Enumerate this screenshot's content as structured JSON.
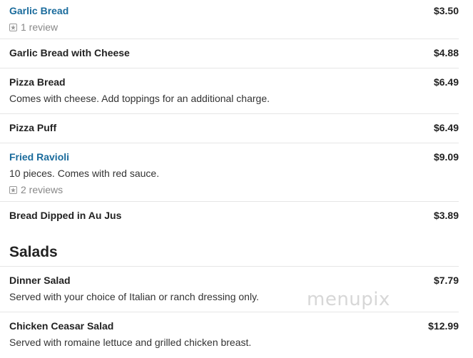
{
  "items": [
    {
      "name": "Garlic Bread",
      "price": "$3.50",
      "reviews": "1 review"
    },
    {
      "name": "Garlic Bread with Cheese",
      "price": "$4.88"
    },
    {
      "name": "Pizza Bread",
      "price": "$6.49",
      "description": "Comes with cheese. Add toppings for an additional charge."
    },
    {
      "name": "Pizza Puff",
      "price": "$6.49"
    },
    {
      "name": "Fried Ravioli",
      "price": "$9.09",
      "description": "10 pieces. Comes with red sauce.",
      "reviews": "2 reviews"
    },
    {
      "name": "Bread Dipped in Au Jus",
      "price": "$3.89"
    }
  ],
  "salads_section": {
    "title": "Salads",
    "items": [
      {
        "name": "Dinner Salad",
        "price": "$7.79",
        "description": "Served with your choice of Italian or ranch dressing only."
      },
      {
        "name": "Chicken Ceasar Salad",
        "price": "$12.99",
        "description": "Served with romaine lettuce and grilled chicken breast."
      }
    ]
  },
  "watermark": "menupix",
  "colors": {
    "link": "#1a6b9c",
    "text": "#222222",
    "muted": "#888888",
    "divider": "#e6e6e6"
  }
}
